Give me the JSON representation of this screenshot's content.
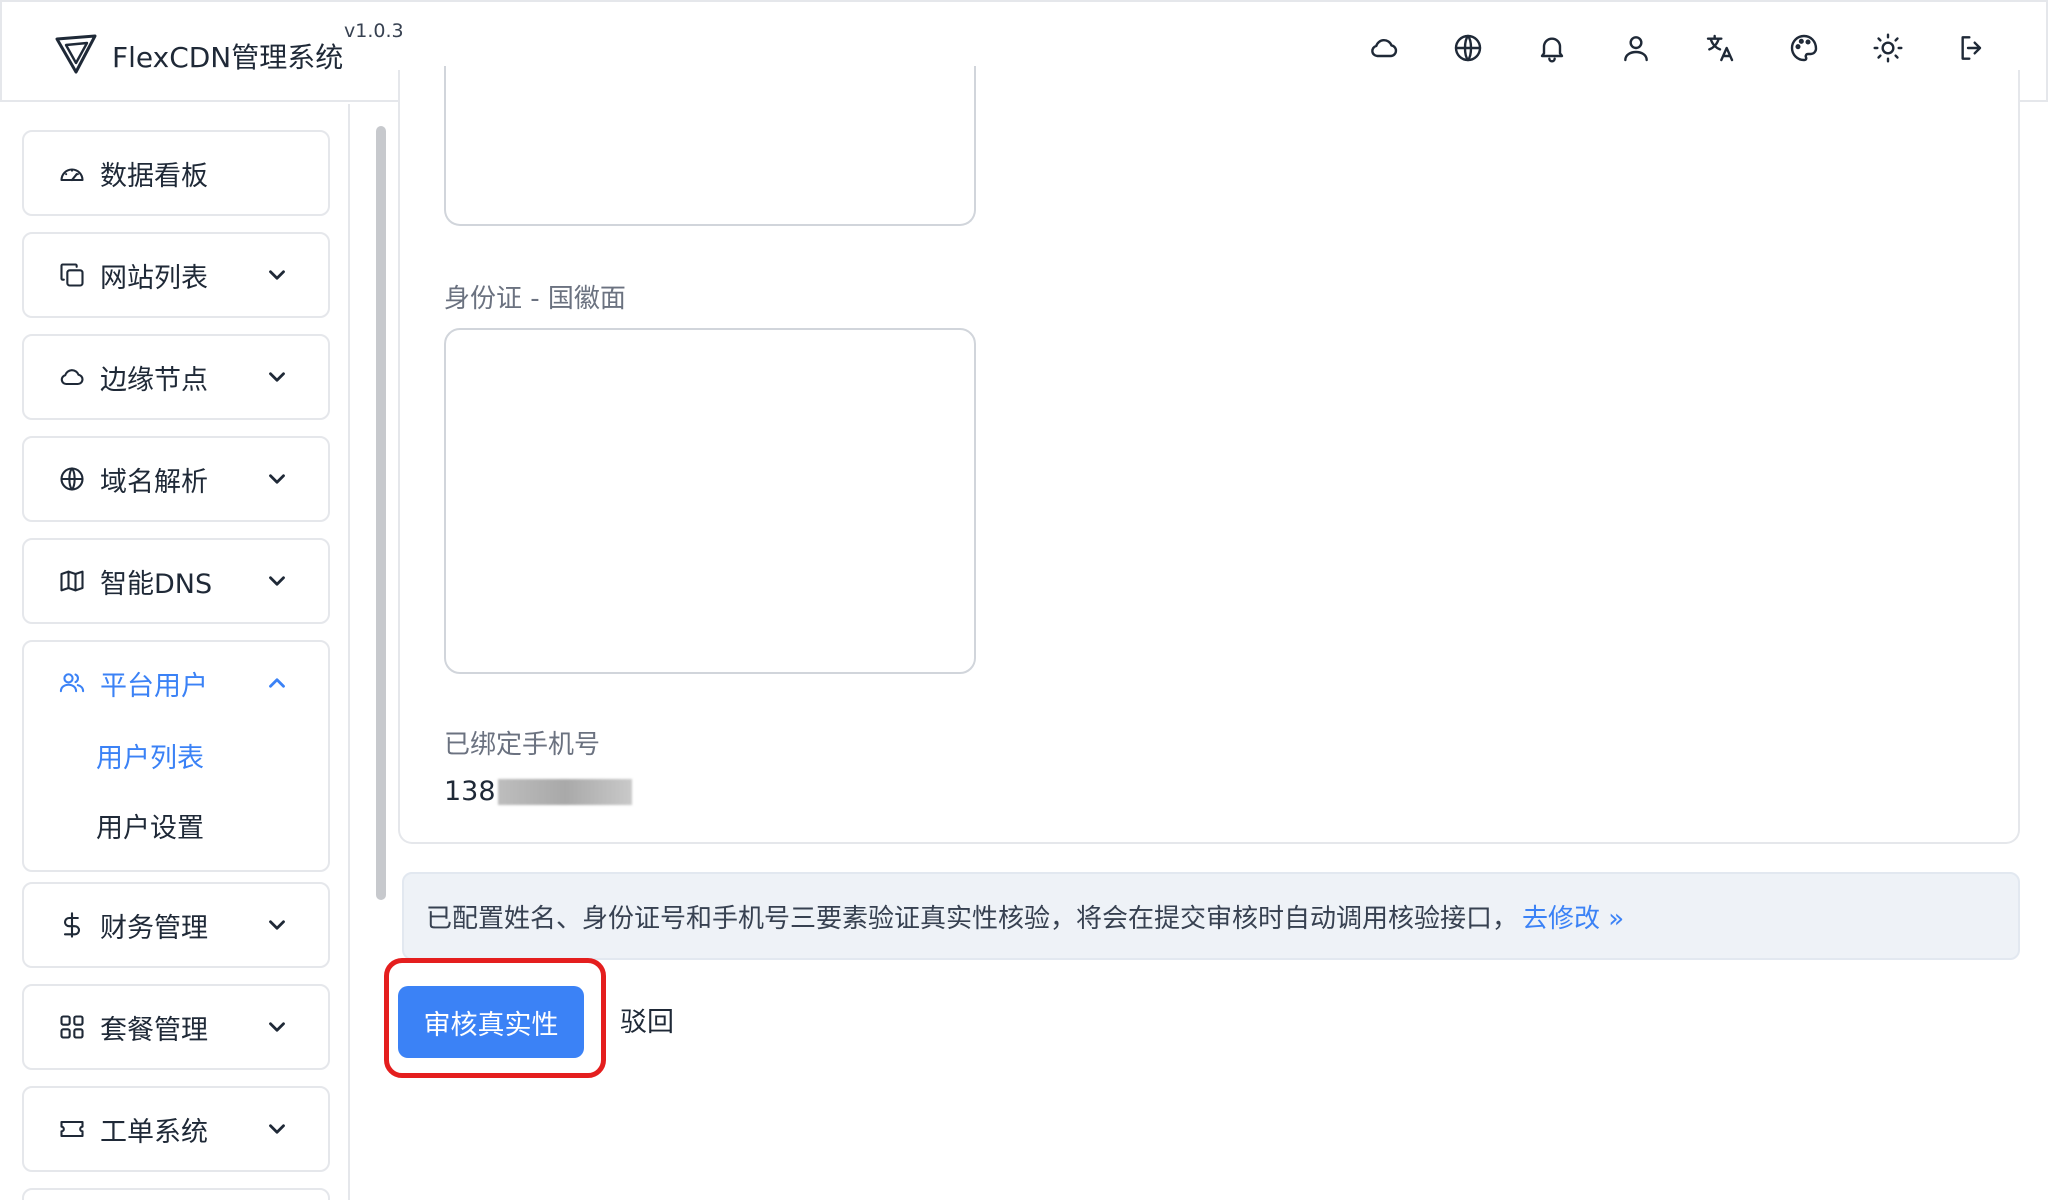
{
  "header": {
    "app_name": "FlexCDN管理系统",
    "version": "v1.0.3",
    "icons": [
      "cloud-icon",
      "globe-icon",
      "bell-icon",
      "user-icon",
      "translate-icon",
      "palette-icon",
      "sun-icon",
      "logout-icon"
    ]
  },
  "sidebar": {
    "items": [
      {
        "label": "数据看板",
        "icon": "dashboard-icon"
      },
      {
        "label": "网站列表",
        "icon": "copy-icon"
      },
      {
        "label": "边缘节点",
        "icon": "cloud-icon"
      },
      {
        "label": "域名解析",
        "icon": "globe-icon"
      },
      {
        "label": "智能DNS",
        "icon": "map-icon"
      },
      {
        "label": "平台用户",
        "icon": "users-icon",
        "expanded": true,
        "sub": [
          "用户列表",
          "用户设置"
        ]
      },
      {
        "label": "财务管理",
        "icon": "dollar-icon"
      },
      {
        "label": "套餐管理",
        "icon": "grid-icon"
      },
      {
        "label": "工单系统",
        "icon": "ticket-icon"
      }
    ],
    "active_sub": "用户列表"
  },
  "main": {
    "id_back_label": "身份证 - 国徽面",
    "phone_label": "已绑定手机号",
    "phone_prefix": "138",
    "notice_text": "已配置姓名、身份证号和手机号三要素验证真实性核验，将会在提交审核时自动调用核验接口，",
    "notice_link": "去修改 »",
    "approve_button": "审核真实性",
    "reject_button": "驳回"
  },
  "colors": {
    "accent": "#3b82f6",
    "highlight": "#e41e1e",
    "notice_bg": "#eef2f7"
  }
}
